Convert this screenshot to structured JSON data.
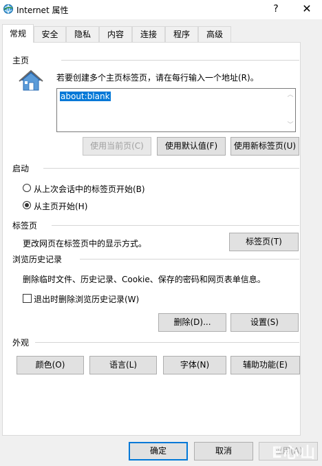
{
  "window": {
    "title": "Internet 属性",
    "help_glyph": "?",
    "close_glyph": "✕"
  },
  "tabs": [
    {
      "label": "常规",
      "active": true
    },
    {
      "label": "安全"
    },
    {
      "label": "隐私"
    },
    {
      "label": "内容"
    },
    {
      "label": "连接"
    },
    {
      "label": "程序"
    },
    {
      "label": "高级"
    }
  ],
  "home": {
    "group_label": "主页",
    "instruction": "若要创建多个主页标签页，请在每行输入一个地址(R)。",
    "value": "about:blank",
    "buttons": {
      "use_current": "使用当前页(C)",
      "use_default": "使用默认值(F)",
      "use_new_tab": "使用新标签页(U)"
    }
  },
  "startup": {
    "group_label": "启动",
    "options": [
      {
        "label": "从上次会话中的标签页开始(B)",
        "checked": false
      },
      {
        "label": "从主页开始(H)",
        "checked": true
      }
    ]
  },
  "tabs_group": {
    "group_label": "标签页",
    "description": "更改网页在标签页中的显示方式。",
    "button": "标签页(T)"
  },
  "history": {
    "group_label": "浏览历史记录",
    "description": "删除临时文件、历史记录、Cookie、保存的密码和网页表单信息。",
    "checkbox_label": "退出时删除浏览历史记录(W)",
    "delete_button": "删除(D)...",
    "settings_button": "设置(S)"
  },
  "appearance": {
    "group_label": "外观",
    "buttons": [
      "颜色(O)",
      "语言(L)",
      "字体(N)",
      "辅助功能(E)"
    ]
  },
  "footer": {
    "ok": "确定",
    "cancel": "取消",
    "apply": "应用(A)"
  },
  "watermark": "E心山林"
}
